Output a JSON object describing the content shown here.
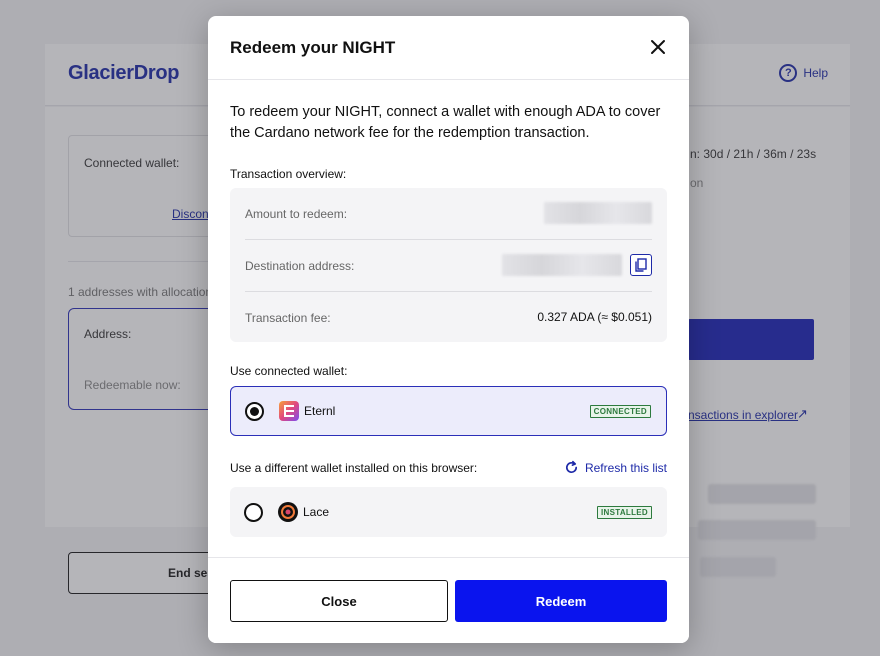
{
  "background": {
    "logo": "GlacierDrop",
    "help_label": "Help",
    "connected_wallet_label": "Connected wallet:",
    "disconnect_label": "Discon",
    "alloc_count": "1 addresses with allocations",
    "address_label": "Address:",
    "redeemable_label": "Redeemable now:",
    "timer_text": "n: 30d / 21h / 36m / 23s",
    "timer_sub": "on",
    "explorer_link": "nsactions in explorer",
    "end_session_label": "End ses"
  },
  "modal": {
    "title": "Redeem your NIGHT",
    "intro": "To redeem your NIGHT, connect a wallet with enough ADA to cover the Cardano network fee for the redemption transaction.",
    "overview_label": "Transaction overview:",
    "overview": {
      "amount_label": "Amount to redeem:",
      "destination_label": "Destination address:",
      "fee_label": "Transaction fee:",
      "fee_value": "0.327 ADA (≈ $0.051)"
    },
    "connected_section_label": "Use connected wallet:",
    "connected_wallet": {
      "name": "Eternl",
      "badge": "CONNECTED"
    },
    "other_section_label": "Use a different wallet installed on this browser:",
    "refresh_label": "Refresh this list",
    "other_wallet": {
      "name": "Lace",
      "badge": "INSTALLED"
    },
    "close_label": "Close",
    "redeem_label": "Redeem"
  },
  "colors": {
    "accent": "#0a14ee",
    "brand": "#1e2aa8",
    "badge_green": "#2d7a3e"
  }
}
